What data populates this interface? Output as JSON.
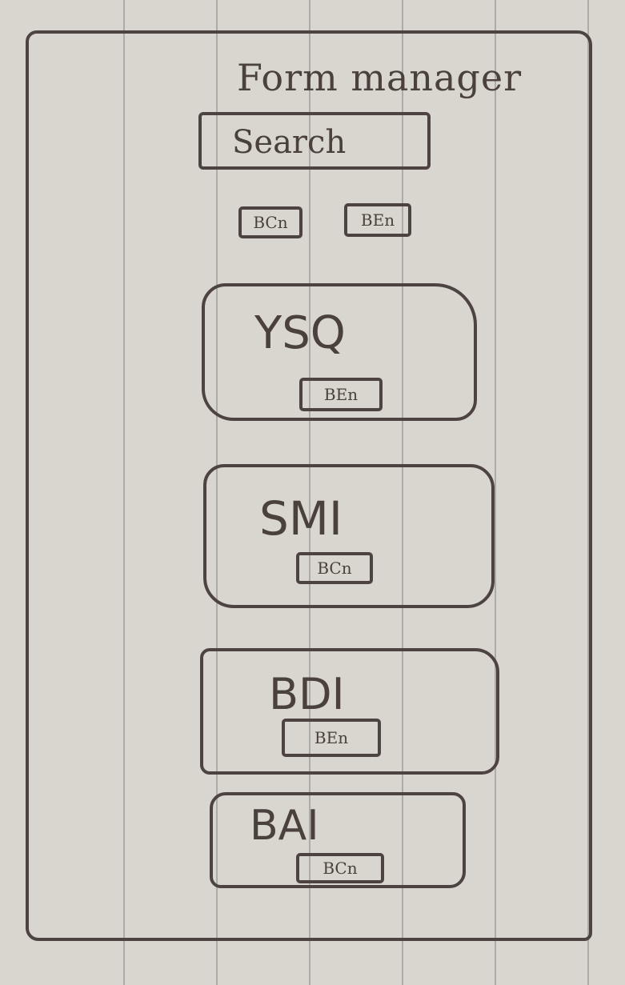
{
  "header": {
    "title": "Form manager"
  },
  "search": {
    "placeholder": "Search"
  },
  "toolbar": {
    "buttons": [
      {
        "label": "BCn"
      },
      {
        "label": "BEn"
      }
    ]
  },
  "forms": [
    {
      "name": "YSQ",
      "button_label": "BEn"
    },
    {
      "name": "SMI",
      "button_label": "BCn"
    },
    {
      "name": "BDI",
      "button_label": "BEn"
    },
    {
      "name": "BAI",
      "button_label": "BCn"
    }
  ],
  "colors": {
    "paper": "#d9d6cf",
    "ink": "#4d4340",
    "rule_lines": "#8a8a8a"
  }
}
